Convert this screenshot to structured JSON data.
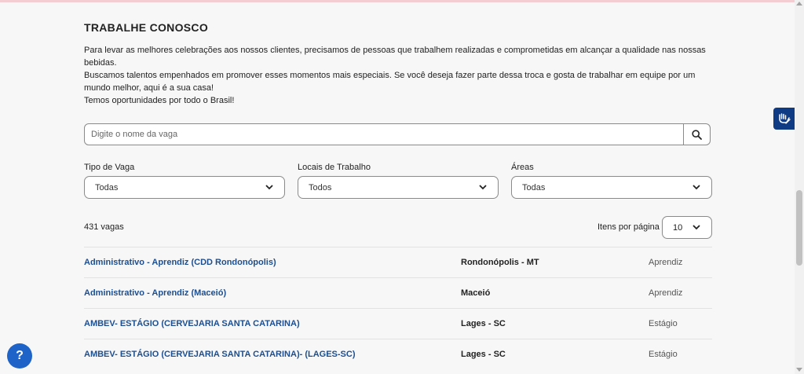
{
  "page": {
    "title": "TRABALHE CONOSCO",
    "intro": [
      "Para levar as melhores celebrações aos nossos clientes, precisamos de pessoas que trabalhem realizadas e comprometidas em alcançar a qualidade nas nossas bebidas.",
      "Buscamos talentos empenhados em promover esses momentos mais especiais. Se você deseja fazer parte dessa troca e gosta de trabalhar em equipe por um mundo melhor, aqui é a sua casa!",
      "Temos oportunidades por todo o Brasil!"
    ]
  },
  "search": {
    "placeholder": "Digite o nome da vaga",
    "icon": "search-icon"
  },
  "filters": [
    {
      "label": "Tipo de Vaga",
      "value": "Todas"
    },
    {
      "label": "Locais de Trabalho",
      "value": "Todos"
    },
    {
      "label": "Áreas",
      "value": "Todas"
    }
  ],
  "results": {
    "count_text": "431 vagas",
    "per_page_label": "Itens por página",
    "per_page_value": "10"
  },
  "jobs": [
    {
      "title": "Administrativo - Aprendiz (CDD Rondonópolis)",
      "location": "Rondonópolis - MT",
      "type": "Aprendiz"
    },
    {
      "title": "Administrativo - Aprendiz (Maceió)",
      "location": "Maceió",
      "type": "Aprendiz"
    },
    {
      "title": "AMBEV- ESTÁGIO (CERVEJARIA SANTA CATARINA)",
      "location": "Lages - SC",
      "type": "Estágio"
    },
    {
      "title": "AMBEV- ESTÁGIO (CERVEJARIA SANTA CATARINA)- (LAGES-SC)",
      "location": "Lages - SC",
      "type": "Estágio"
    }
  ],
  "widgets": {
    "help_label": "?",
    "accessibility_icon": "sign-language-icon",
    "help_icon": "help-icon"
  },
  "colors": {
    "link": "#1d4e8f",
    "accessibility_bg": "#0f3a84",
    "help_bg": "#1e63c7",
    "background": "#f7f7f7"
  }
}
